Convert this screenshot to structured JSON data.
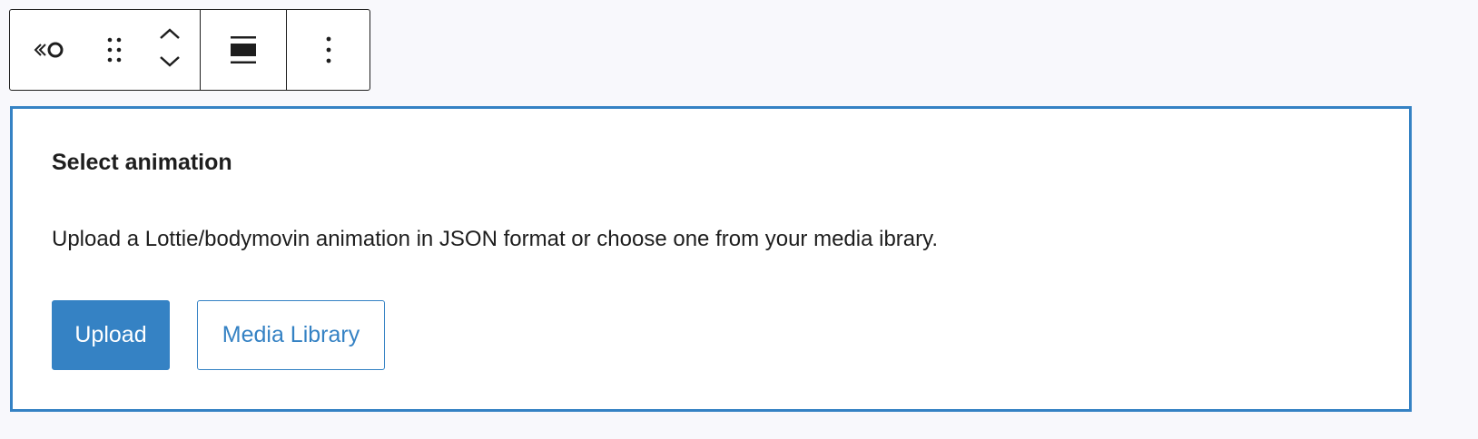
{
  "toolbar": {
    "block_icon": "lottie-block-icon",
    "drag_icon": "drag-handle-icon",
    "move_up_icon": "chevron-up-icon",
    "move_down_icon": "chevron-down-icon",
    "align_icon": "align-wide-icon",
    "more_icon": "more-vertical-icon"
  },
  "placeholder": {
    "title": "Select animation",
    "instructions": "Upload a Lottie/bodymovin animation in JSON format or choose one from your media ibrary.",
    "upload_label": "Upload",
    "media_library_label": "Media Library"
  },
  "colors": {
    "accent": "#3582c4",
    "text": "#1e1e1e",
    "page_background": "#f8f8fc"
  }
}
